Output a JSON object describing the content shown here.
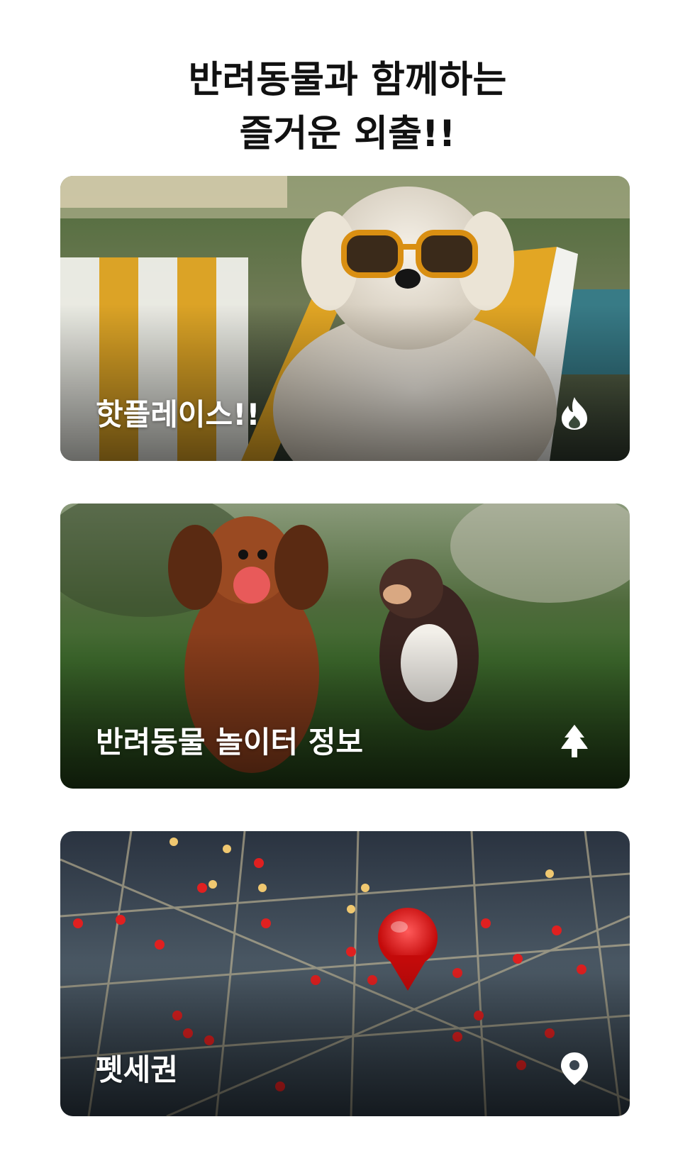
{
  "headline": {
    "line1": "반려동물과 함께하는",
    "line2": "즐거운 외출!!"
  },
  "cards": [
    {
      "label": "핫플레이스!!",
      "icon": "flame-icon"
    },
    {
      "label": "반려동물 놀이터 정보",
      "icon": "tree-icon"
    },
    {
      "label": "펫세권",
      "icon": "location-pin-icon"
    }
  ],
  "colors": {
    "text": "#111111",
    "card_label": "#ffffff",
    "accent_red": "#e01414"
  }
}
